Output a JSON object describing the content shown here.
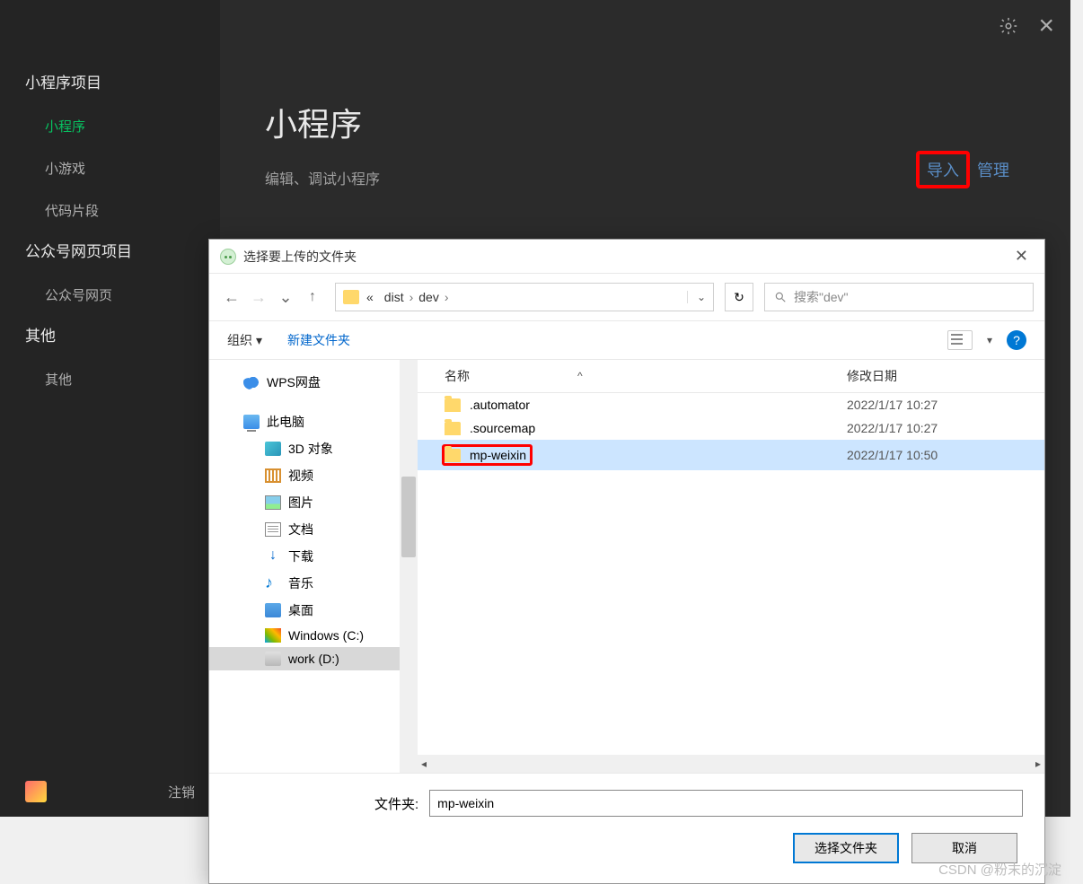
{
  "sidebar": {
    "section1_title": "小程序项目",
    "items1": [
      "小程序",
      "小游戏",
      "代码片段"
    ],
    "section2_title": "公众号网页项目",
    "items2": [
      "公众号网页"
    ],
    "section3_title": "其他",
    "items3": [
      "其他"
    ],
    "logout": "注销"
  },
  "main": {
    "title": "小程序",
    "subtitle": "编辑、调试小程序",
    "import_btn": "导入",
    "manage_btn": "管理"
  },
  "dialog": {
    "title": "选择要上传的文件夹",
    "breadcrumb_prefix": "«",
    "crumbs": [
      "dist",
      "dev"
    ],
    "search_placeholder": "搜索\"dev\"",
    "organize": "组织",
    "new_folder": "新建文件夹",
    "col_name": "名称",
    "col_date": "修改日期",
    "tree": [
      {
        "label": "WPS网盘",
        "icon": "cloud",
        "indent": 1
      },
      {
        "label": "此电脑",
        "icon": "pc",
        "indent": 1
      },
      {
        "label": "3D 对象",
        "icon": "3d",
        "indent": 2
      },
      {
        "label": "视频",
        "icon": "vid",
        "indent": 2
      },
      {
        "label": "图片",
        "icon": "img",
        "indent": 2
      },
      {
        "label": "文档",
        "icon": "doc",
        "indent": 2
      },
      {
        "label": "下载",
        "icon": "dl",
        "indent": 2
      },
      {
        "label": "音乐",
        "icon": "mus",
        "indent": 2
      },
      {
        "label": "桌面",
        "icon": "desk",
        "indent": 2
      },
      {
        "label": "Windows (C:)",
        "icon": "win",
        "indent": 2
      },
      {
        "label": "work (D:)",
        "icon": "drv",
        "indent": 2,
        "selected": true
      }
    ],
    "files": [
      {
        "name": ".automator",
        "date": "2022/1/17 10:27"
      },
      {
        "name": ".sourcemap",
        "date": "2022/1/17 10:27"
      },
      {
        "name": "mp-weixin",
        "date": "2022/1/17 10:50",
        "selected": true,
        "highlight": true
      }
    ],
    "folder_label": "文件夹:",
    "folder_value": "mp-weixin",
    "select_btn": "选择文件夹",
    "cancel_btn": "取消"
  },
  "watermark": "CSDN @粉末的沉淀"
}
